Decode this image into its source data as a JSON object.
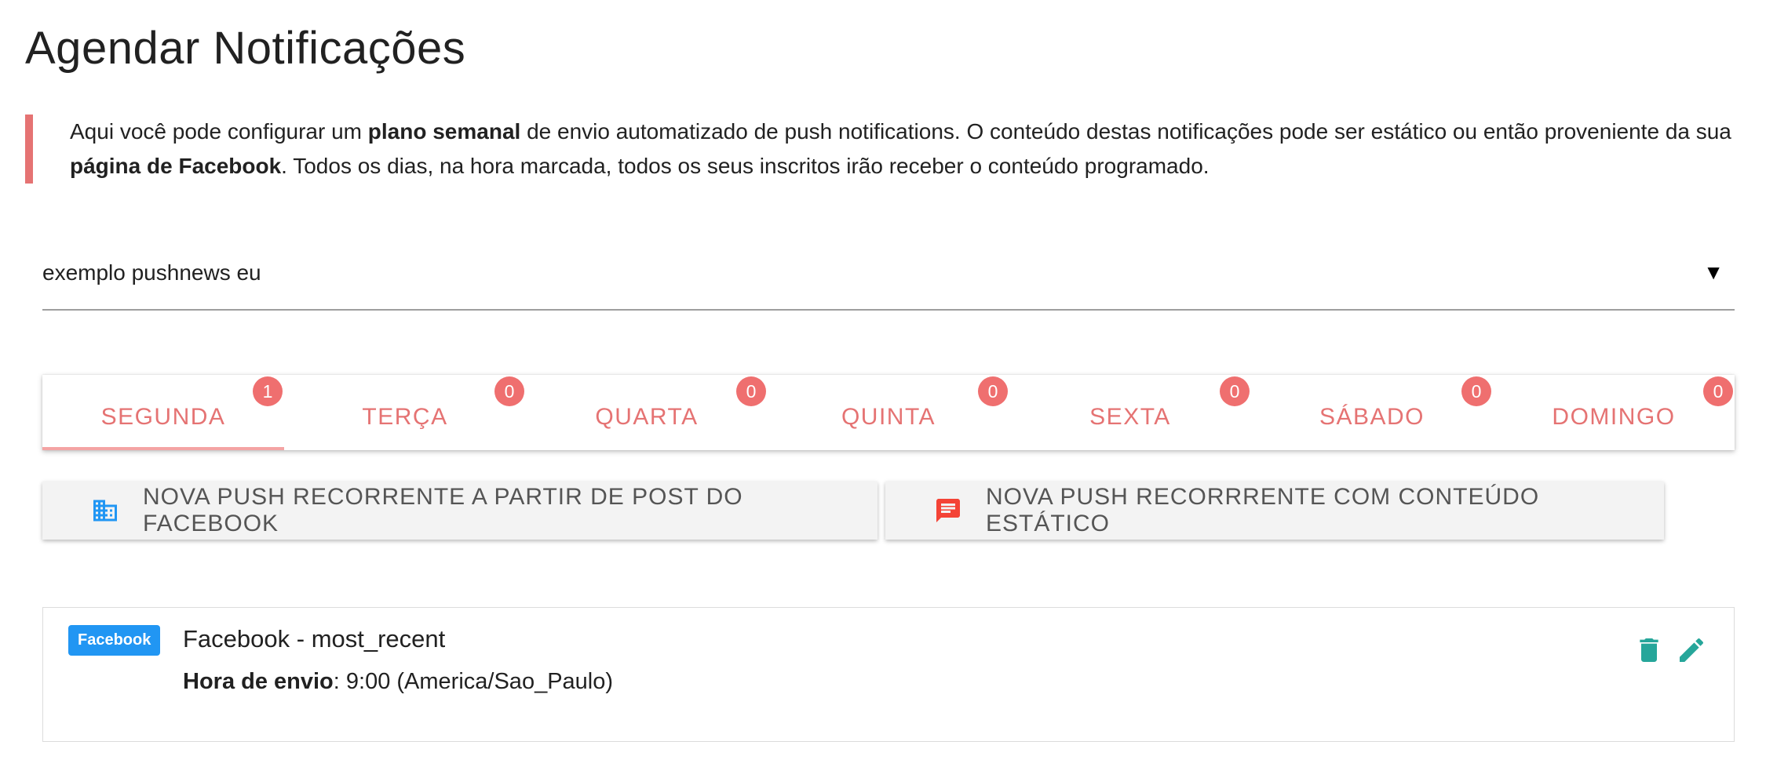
{
  "page": {
    "title": "Agendar Notificações"
  },
  "intro": {
    "part1": "Aqui você pode configurar um ",
    "bold1": "plano semanal",
    "part2": " de envio automatizado de push notifications. O conteúdo destas notificações pode ser estático ou então proveniente da sua ",
    "bold2": "página de Facebook",
    "part3": ". Todos os dias, na hora marcada, todos os seus inscritos irão receber o conteúdo programado."
  },
  "site_select": {
    "value": "exemplo pushnews eu",
    "arrow": "▼"
  },
  "tabs": [
    {
      "label": "SEGUNDA",
      "count": "1",
      "active": true
    },
    {
      "label": "TERÇA",
      "count": "0",
      "active": false
    },
    {
      "label": "QUARTA",
      "count": "0",
      "active": false
    },
    {
      "label": "QUINTA",
      "count": "0",
      "active": false
    },
    {
      "label": "SEXTA",
      "count": "0",
      "active": false
    },
    {
      "label": "SÁBADO",
      "count": "0",
      "active": false
    },
    {
      "label": "DOMINGO",
      "count": "0",
      "active": false
    }
  ],
  "actions": {
    "facebook_label": "NOVA PUSH RECORRENTE A PARTIR DE POST DO FACEBOOK",
    "facebook_icon": "business-icon",
    "static_label": "NOVA PUSH RECORRRENTE COM CONTEÚDO ESTÁTICO",
    "static_icon": "message-icon"
  },
  "schedule_item": {
    "tag": "Facebook",
    "title": "Facebook - most_recent",
    "time_label": "Hora de envio",
    "time_value": ": 9:00 (America/Sao_Paulo)",
    "delete_icon": "trash-icon",
    "edit_icon": "pencil-icon"
  },
  "colors": {
    "accent": "#e57373",
    "badge": "#ef6f6f",
    "tag": "#2196f3",
    "action_icon": "#26a69a",
    "fb_icon": "#2196f3",
    "static_icon": "#f44336"
  }
}
